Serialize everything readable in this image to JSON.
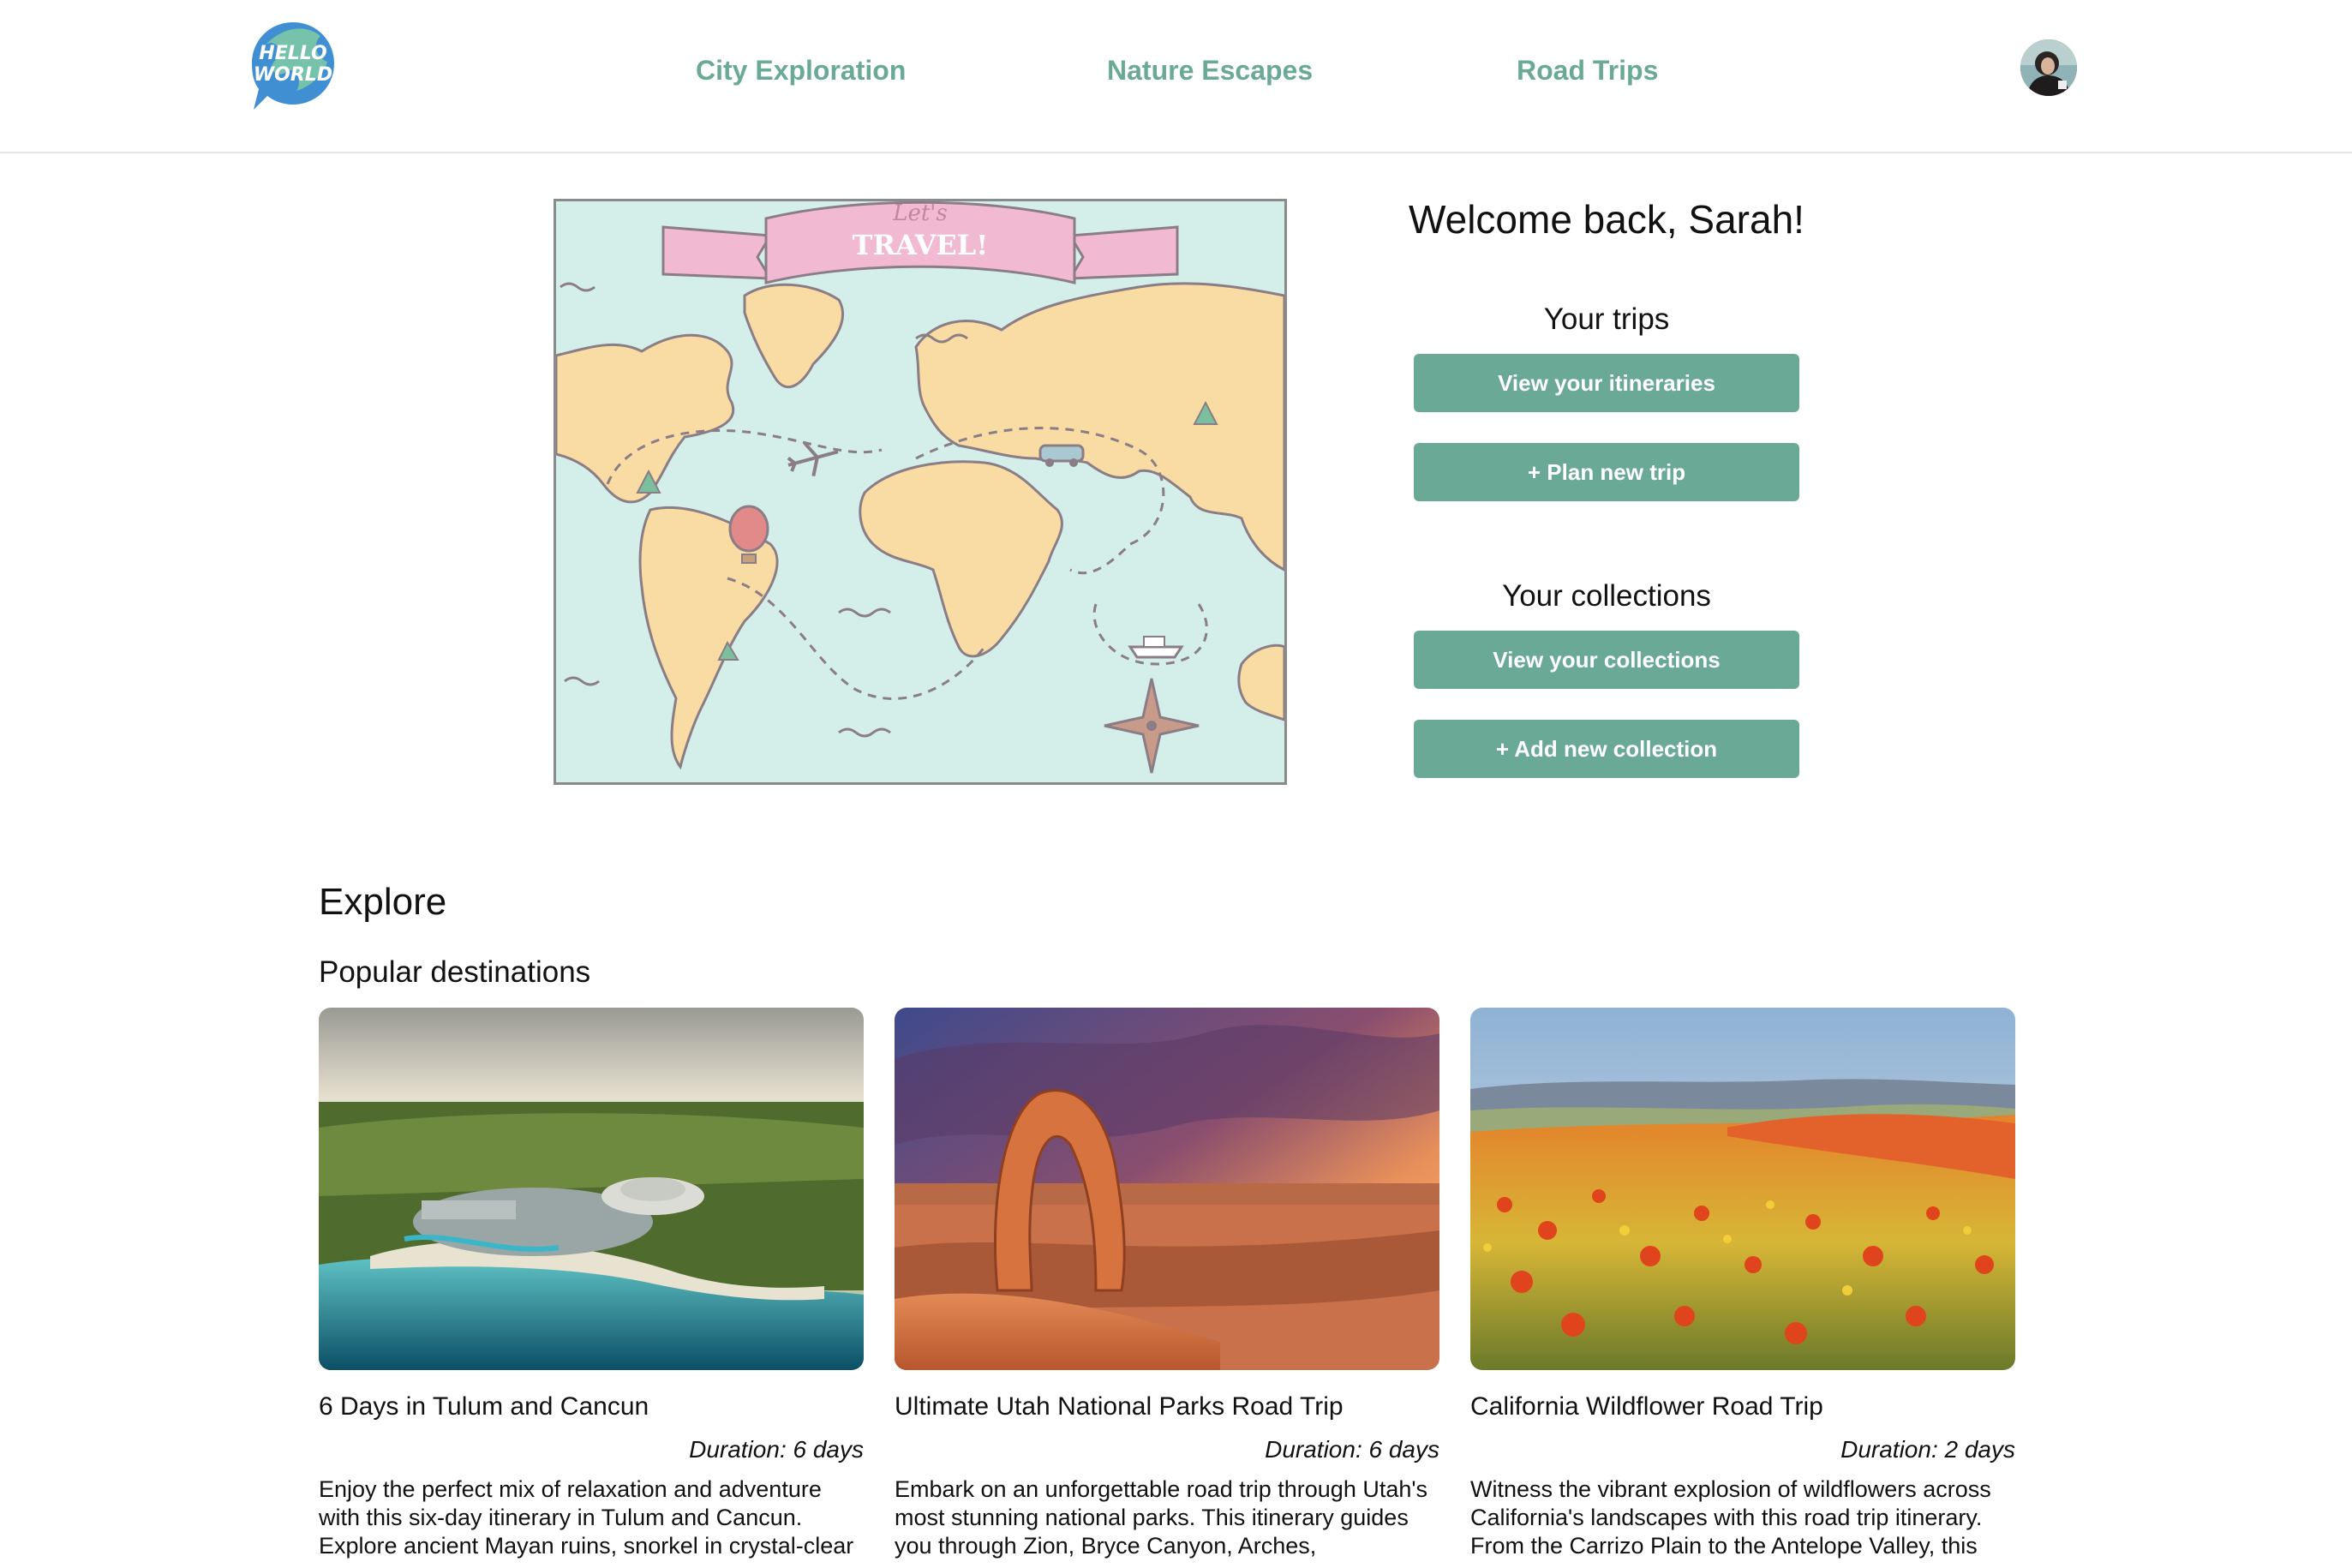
{
  "nav": {
    "logo_text_line1": "HELLO",
    "logo_text_line2": "WORLD",
    "links": [
      "City Exploration",
      "Nature Escapes",
      "Road Trips"
    ],
    "accent_color": "#6aa996"
  },
  "hero": {
    "banner_line1": "Let's",
    "banner_line2": "TRAVEL!"
  },
  "sidebar": {
    "welcome": "Welcome back, Sarah!",
    "trips_heading": "Your trips",
    "view_itineraries": "View your itineraries",
    "plan_new_trip": "+ Plan new trip",
    "collections_heading": "Your collections",
    "view_collections": "View your collections",
    "add_collection": "+ Add new collection"
  },
  "explore": {
    "title": "Explore",
    "subtitle": "Popular destinations",
    "cards": [
      {
        "title": "6 Days in Tulum and Cancun",
        "duration": "Duration: 6 days",
        "description": "Enjoy the perfect mix of relaxation and adventure with this six-day itinerary in Tulum and Cancun. Explore ancient Mayan ruins, snorkel in crystal-clear"
      },
      {
        "title": "Ultimate Utah National Parks Road Trip",
        "duration": "Duration: 6 days",
        "description": "Embark on an unforgettable road trip through Utah's most stunning national parks. This itinerary guides you through Zion, Bryce Canyon, Arches,"
      },
      {
        "title": "California Wildflower Road Trip",
        "duration": "Duration: 2 days",
        "description": "Witness the vibrant explosion of wildflowers across California's landscapes with this road trip itinerary. From the Carrizo Plain to the Antelope Valley, this"
      }
    ]
  }
}
